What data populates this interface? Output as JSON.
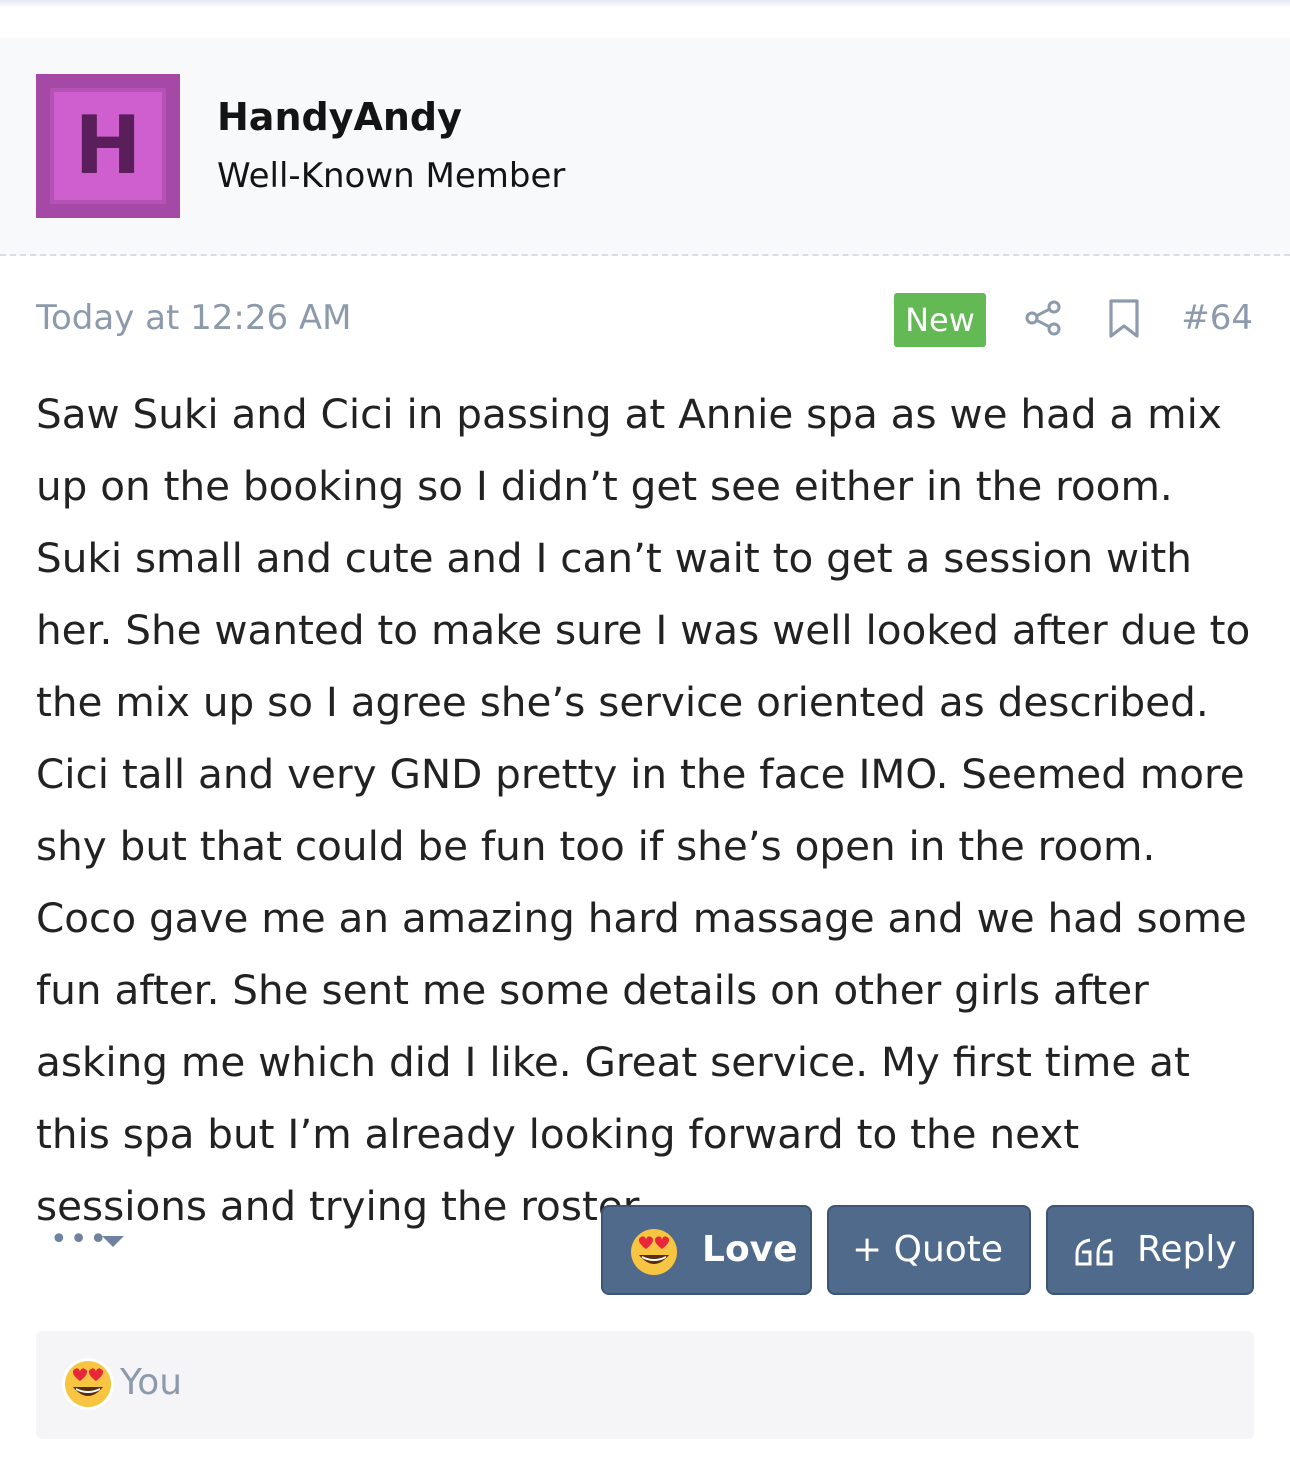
{
  "author": {
    "avatar_letter": "H",
    "avatar_color": "#cf5fcf",
    "username": "HandyAndy",
    "title": "Well-Known Member"
  },
  "meta": {
    "date": "Today at 12:26 AM",
    "new_badge": "New",
    "new_badge_color": "#63b954",
    "post_number": "#64",
    "share_icon": "share-icon",
    "bookmark_icon": "bookmark-icon"
  },
  "message": "Saw Suki and Cici in passing at Annie spa as we had a mix up on the booking so I didn’t get see either in the room. Suki small and cute and I can’t wait to get a session with her. She wanted to make sure I was well looked after due to the mix up so I agree she’s service oriented as described. Cici tall and very GND pretty in the face IMO. Seemed more shy but that could be fun too if she’s open in the room. Coco gave me an amazing hard massage and we had some fun after. She sent me some details on other girls after asking me which did I like. Great service. My first time at this spa but I’m already looking forward to the next sessions and trying the roster.",
  "actions": {
    "more_dots": "•••",
    "love_label": "Love",
    "quote_label": "+ Quote",
    "reply_label": "Reply",
    "button_color": "#506a8b"
  },
  "reactions": {
    "summary": "You",
    "icon": "heart-eyes-emoji-icon"
  }
}
